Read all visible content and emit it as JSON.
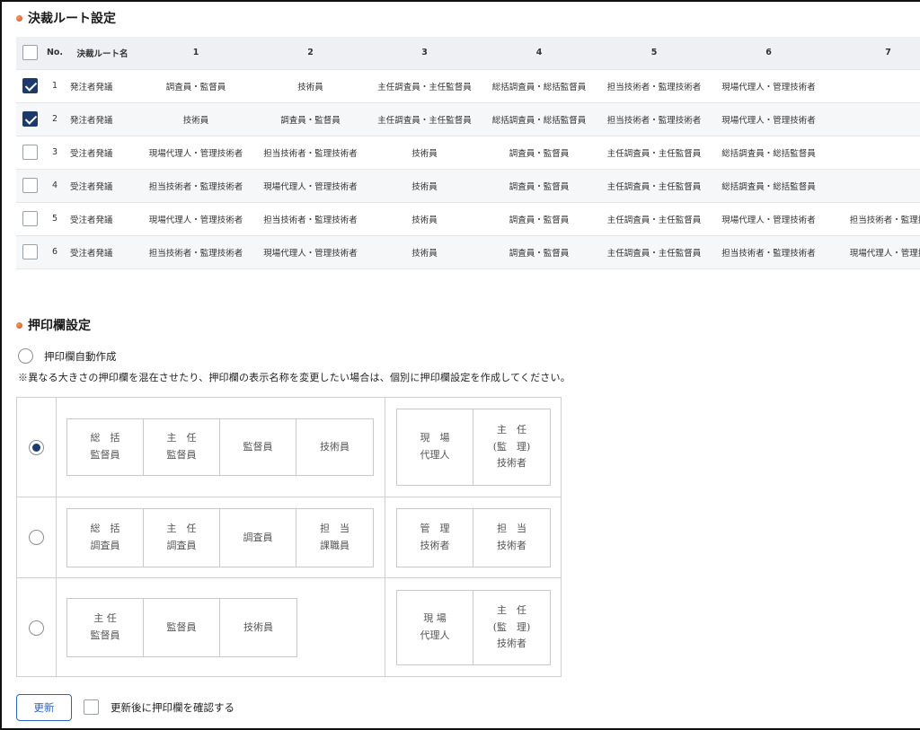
{
  "route_section": {
    "title": "決裁ルート設定"
  },
  "route_table": {
    "headers": [
      "No.",
      "決裁ルート名",
      "1",
      "2",
      "3",
      "4",
      "5",
      "6",
      "7"
    ],
    "rows": [
      {
        "checked": true,
        "no": "1",
        "name": "発注者発議",
        "steps": [
          "調査員・監督員",
          "技術員",
          "主任調査員・主任監督員",
          "総括調査員・総括監督員",
          "担当技術者・監理技術者",
          "現場代理人・管理技術者",
          ""
        ]
      },
      {
        "checked": true,
        "no": "2",
        "name": "発注者発議",
        "steps": [
          "技術員",
          "調査員・監督員",
          "主任調査員・主任監督員",
          "総括調査員・総括監督員",
          "担当技術者・監理技術者",
          "現場代理人・管理技術者",
          ""
        ]
      },
      {
        "checked": false,
        "no": "3",
        "name": "受注者発議",
        "steps": [
          "現場代理人・管理技術者",
          "担当技術者・監理技術者",
          "技術員",
          "調査員・監督員",
          "主任調査員・主任監督員",
          "総括調査員・総括監督員",
          ""
        ]
      },
      {
        "checked": false,
        "no": "4",
        "name": "受注者発議",
        "steps": [
          "担当技術者・監理技術者",
          "現場代理人・管理技術者",
          "技術員",
          "調査員・監督員",
          "主任調査員・主任監督員",
          "総括調査員・総括監督員",
          ""
        ]
      },
      {
        "checked": false,
        "no": "5",
        "name": "受注者発議",
        "steps": [
          "現場代理人・管理技術者",
          "担当技術者・監理技術者",
          "技術員",
          "調査員・監督員",
          "主任調査員・主任監督員",
          "現場代理人・管理技術者",
          "担当技術者・監理技"
        ]
      },
      {
        "checked": false,
        "no": "6",
        "name": "受注者発議",
        "steps": [
          "担当技術者・監理技術者",
          "現場代理人・管理技術者",
          "技術員",
          "調査員・監督員",
          "主任調査員・主任監督員",
          "担当技術者・監理技術者",
          "現場代理人・管理技"
        ]
      }
    ]
  },
  "stamp_section": {
    "title": "押印欄設定",
    "auto_create_label": "押印欄自動作成",
    "note": "※異なる大きさの押印欄を混在させたり、押印欄の表示名称を変更したい場合は、個別に押印欄設定を作成してください。",
    "options": [
      {
        "selected": true,
        "left": [
          "総　括\n監督員",
          "主　任\n監督員",
          "監督員",
          "技術員"
        ],
        "right": [
          "現　場\n代理人",
          "主　任\n(監　理)\n技術者"
        ]
      },
      {
        "selected": false,
        "left": [
          "総　括\n調査員",
          "主　任\n調査員",
          "調査員",
          "担　当\n課職員"
        ],
        "right": [
          "管　理\n技術者",
          "担　当\n技術者"
        ]
      },
      {
        "selected": false,
        "left": [
          "主 任\n監督員",
          "監督員",
          "技術員"
        ],
        "right": [
          "現 場\n代理人",
          "主　任\n(監　理)\n技術者"
        ]
      }
    ]
  },
  "footer": {
    "update_label": "更新",
    "confirm_label": "更新後に押印欄を確認する"
  }
}
